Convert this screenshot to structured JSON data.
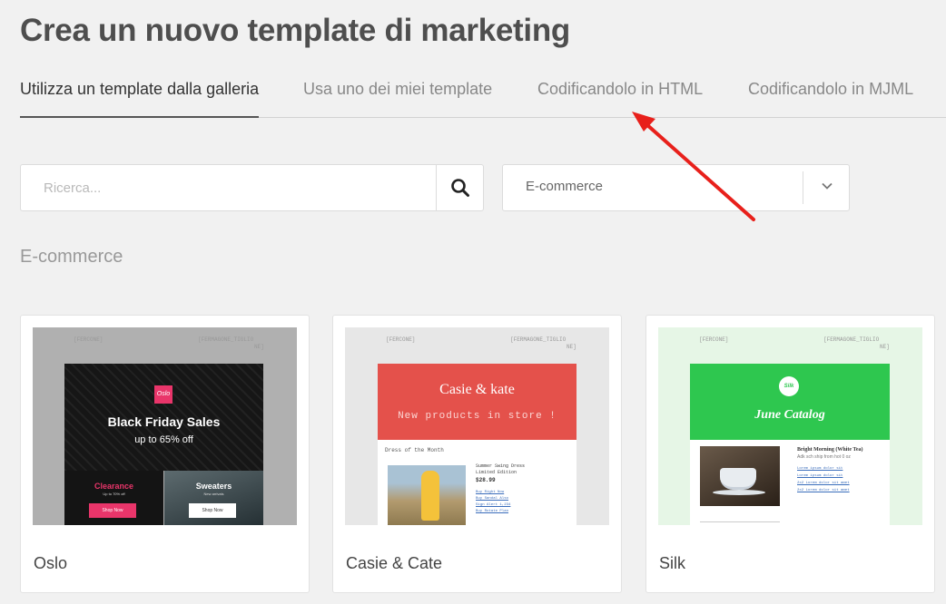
{
  "page": {
    "title": "Crea un nuovo template di marketing"
  },
  "tabs": [
    {
      "label": "Utilizza un template dalla galleria",
      "active": true
    },
    {
      "label": "Usa uno dei miei template",
      "active": false
    },
    {
      "label": "Codificandolo in HTML",
      "active": false
    },
    {
      "label": "Codificandolo in MJML",
      "active": false
    }
  ],
  "search": {
    "placeholder": "Ricerca...",
    "value": "",
    "icon": "search-icon"
  },
  "category_select": {
    "value": "E-commerce",
    "icon": "chevron-down-icon"
  },
  "section": {
    "label": "E-commerce"
  },
  "placeholders": {
    "left": "[FERCONE]",
    "right_line1": "[FERMAGONE_TIGLIO",
    "right_line2": "NE]"
  },
  "templates": [
    {
      "name": "Oslo",
      "preview": {
        "logo": "Oslo",
        "headline": "Black Friday Sales",
        "subheadline": "up to 65% off",
        "left_title": "Clearance",
        "left_sub": "Up to 70% off",
        "left_button": "Shop Now",
        "right_title": "Sweaters",
        "right_sub": "New arrivals",
        "right_button": "Shop Now"
      }
    },
    {
      "name": "Casie & Cate",
      "preview": {
        "brand": "Casie & kate",
        "tagline": "New products in store !",
        "section_title": "Dress of the Month",
        "product_name": "Summer Swing Dress",
        "product_meta": "Limited Edition",
        "price": "$28.99",
        "links": [
          "Buy Right Now",
          "Buy Sandal Also",
          "Sign Alert 1,234",
          "Buy Rotate Plan"
        ]
      }
    },
    {
      "name": "Silk",
      "preview": {
        "logo": "Silk",
        "headline": "June Catalog",
        "product_name": "Bright Morning (White Tea)",
        "product_desc": "Adk sch ship from hot 0 oz",
        "links": [
          "Lorem ipsum dolor sit",
          "Lorem ipsum dolor sit",
          "2x2 Lorem dolor sit amet",
          "2x2 Lorem dolor sit amet"
        ]
      }
    }
  ],
  "colors": {
    "background": "#f1f1f1",
    "oslo_accent": "#e9356a",
    "casie_accent": "#e4514b",
    "silk_accent": "#2ec74f",
    "annotation_arrow": "#e8201b"
  }
}
